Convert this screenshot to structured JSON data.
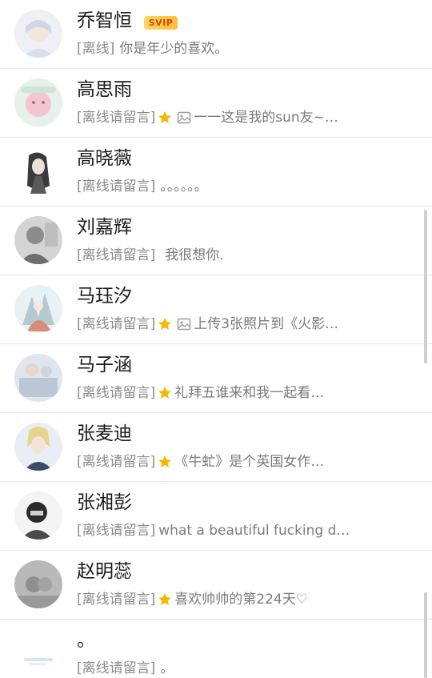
{
  "rows": [
    {
      "name": "乔智恒",
      "badge": "SVIP",
      "status": "[离线]",
      "message": "你是年少的喜欢。"
    },
    {
      "name": "高思雨",
      "status": "[离线请留言]",
      "message": "一一这是我的sun友~…"
    },
    {
      "name": "高晓薇",
      "status": "[离线请留言]",
      "message": "。。。。。。"
    },
    {
      "name": "刘嘉辉",
      "status": "[离线请留言]",
      "message": "我很想你."
    },
    {
      "name": "马珏汐",
      "status": "[离线请留言]",
      "message": "上传3张照片到《火影…"
    },
    {
      "name": "马子涵",
      "status": "[离线请留言]",
      "message": "礼拜五谁来和我一起看…"
    },
    {
      "name": "张麦迪",
      "status": "[离线请留言]",
      "message": "《牛虻》是个英国女作…"
    },
    {
      "name": "张湘彭",
      "status": "[离线请留言]",
      "message": "what a beautiful fucking d…"
    },
    {
      "name": "赵明蕊",
      "status": "[离线请留言]",
      "message": "喜欢帅帅的第224天♡"
    },
    {
      "name": "。",
      "status": "[离线请留言]",
      "message": "。"
    }
  ],
  "colors": {
    "badge": "#ffc94a",
    "star": "#f5b700",
    "separator": "#e6e6e6",
    "secondary_text": "#7a7a7a"
  },
  "icons": {
    "star": "star-icon",
    "image": "image-icon"
  }
}
